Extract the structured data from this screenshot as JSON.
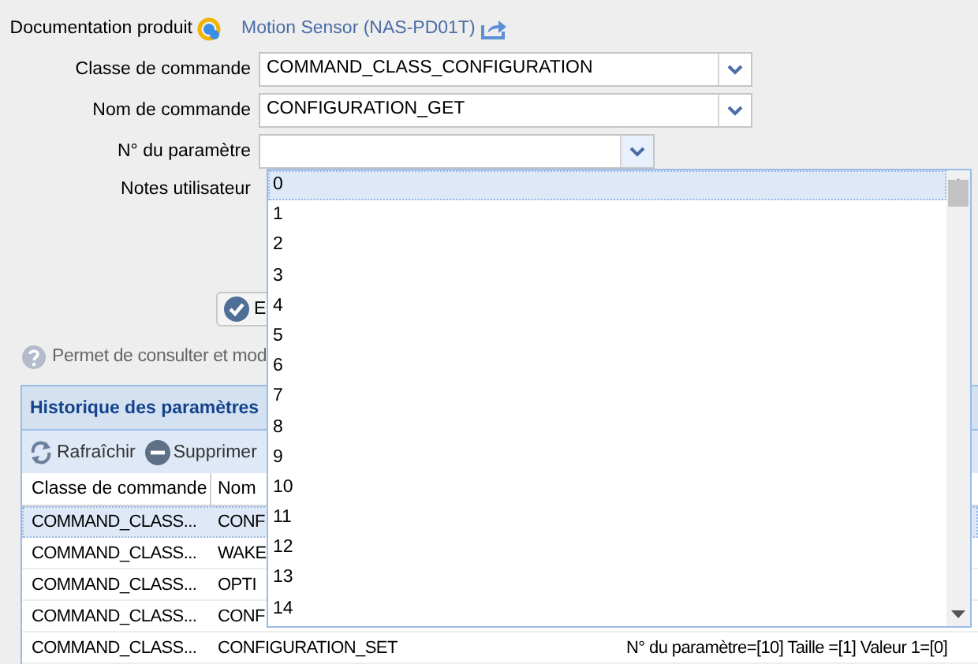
{
  "product_doc": {
    "label": "Documentation produit",
    "link": "Motion Sensor (NAS-PD01T)"
  },
  "fields": [
    {
      "label": "Classe de commande",
      "kind": "combo",
      "value": "COMMAND_CLASS_CONFIGURATION",
      "expanded": false
    },
    {
      "label": "Nom de commande",
      "kind": "combo",
      "value": "CONFIGURATION_GET",
      "expanded": false
    },
    {
      "label": "N° du paramètre",
      "kind": "combo",
      "expanded": true
    },
    {
      "label": "Notes utilisateur",
      "kind": "textarea"
    }
  ],
  "send_button": "E",
  "help_text": "Permet de consulter et mod",
  "history": {
    "title": "Historique des paramètres",
    "toolbar": [
      {
        "label": "Rafraîchir",
        "kind": "refresh"
      },
      {
        "label": "Supprimer",
        "kind": "delete"
      }
    ],
    "columns": [
      "Classe de commande",
      "Nom"
    ],
    "rows": [
      {
        "cells": [
          "COMMAND_CLASS...",
          "CONF"
        ],
        "selected": true
      },
      {
        "cells": [
          "COMMAND_CLASS...",
          "WAKE"
        ],
        "selected": false
      },
      {
        "cells": [
          "COMMAND_CLASS...",
          "OPTI"
        ],
        "selected": false
      },
      {
        "cells": [
          "COMMAND_CLASS...",
          "CONF"
        ],
        "selected": false
      },
      {
        "cells": [
          "COMMAND_CLASS...",
          "CONFIGURATION_SET",
          "N° du paramètre=[10] Taille =[1] Valeur 1=[0]"
        ],
        "selected": false
      }
    ]
  },
  "dropdown": {
    "options": [
      {
        "label": "0",
        "selected": true
      },
      {
        "label": "1",
        "selected": false
      },
      {
        "label": "2",
        "selected": false
      },
      {
        "label": "3",
        "selected": false
      },
      {
        "label": "4",
        "selected": false
      },
      {
        "label": "5",
        "selected": false
      },
      {
        "label": "6",
        "selected": false
      },
      {
        "label": "7",
        "selected": false
      },
      {
        "label": "8",
        "selected": false
      },
      {
        "label": "9",
        "selected": false
      },
      {
        "label": "10",
        "selected": false
      },
      {
        "label": "11",
        "selected": false
      },
      {
        "label": "12",
        "selected": false
      },
      {
        "label": "13",
        "selected": false
      },
      {
        "label": "14",
        "selected": false
      }
    ]
  }
}
